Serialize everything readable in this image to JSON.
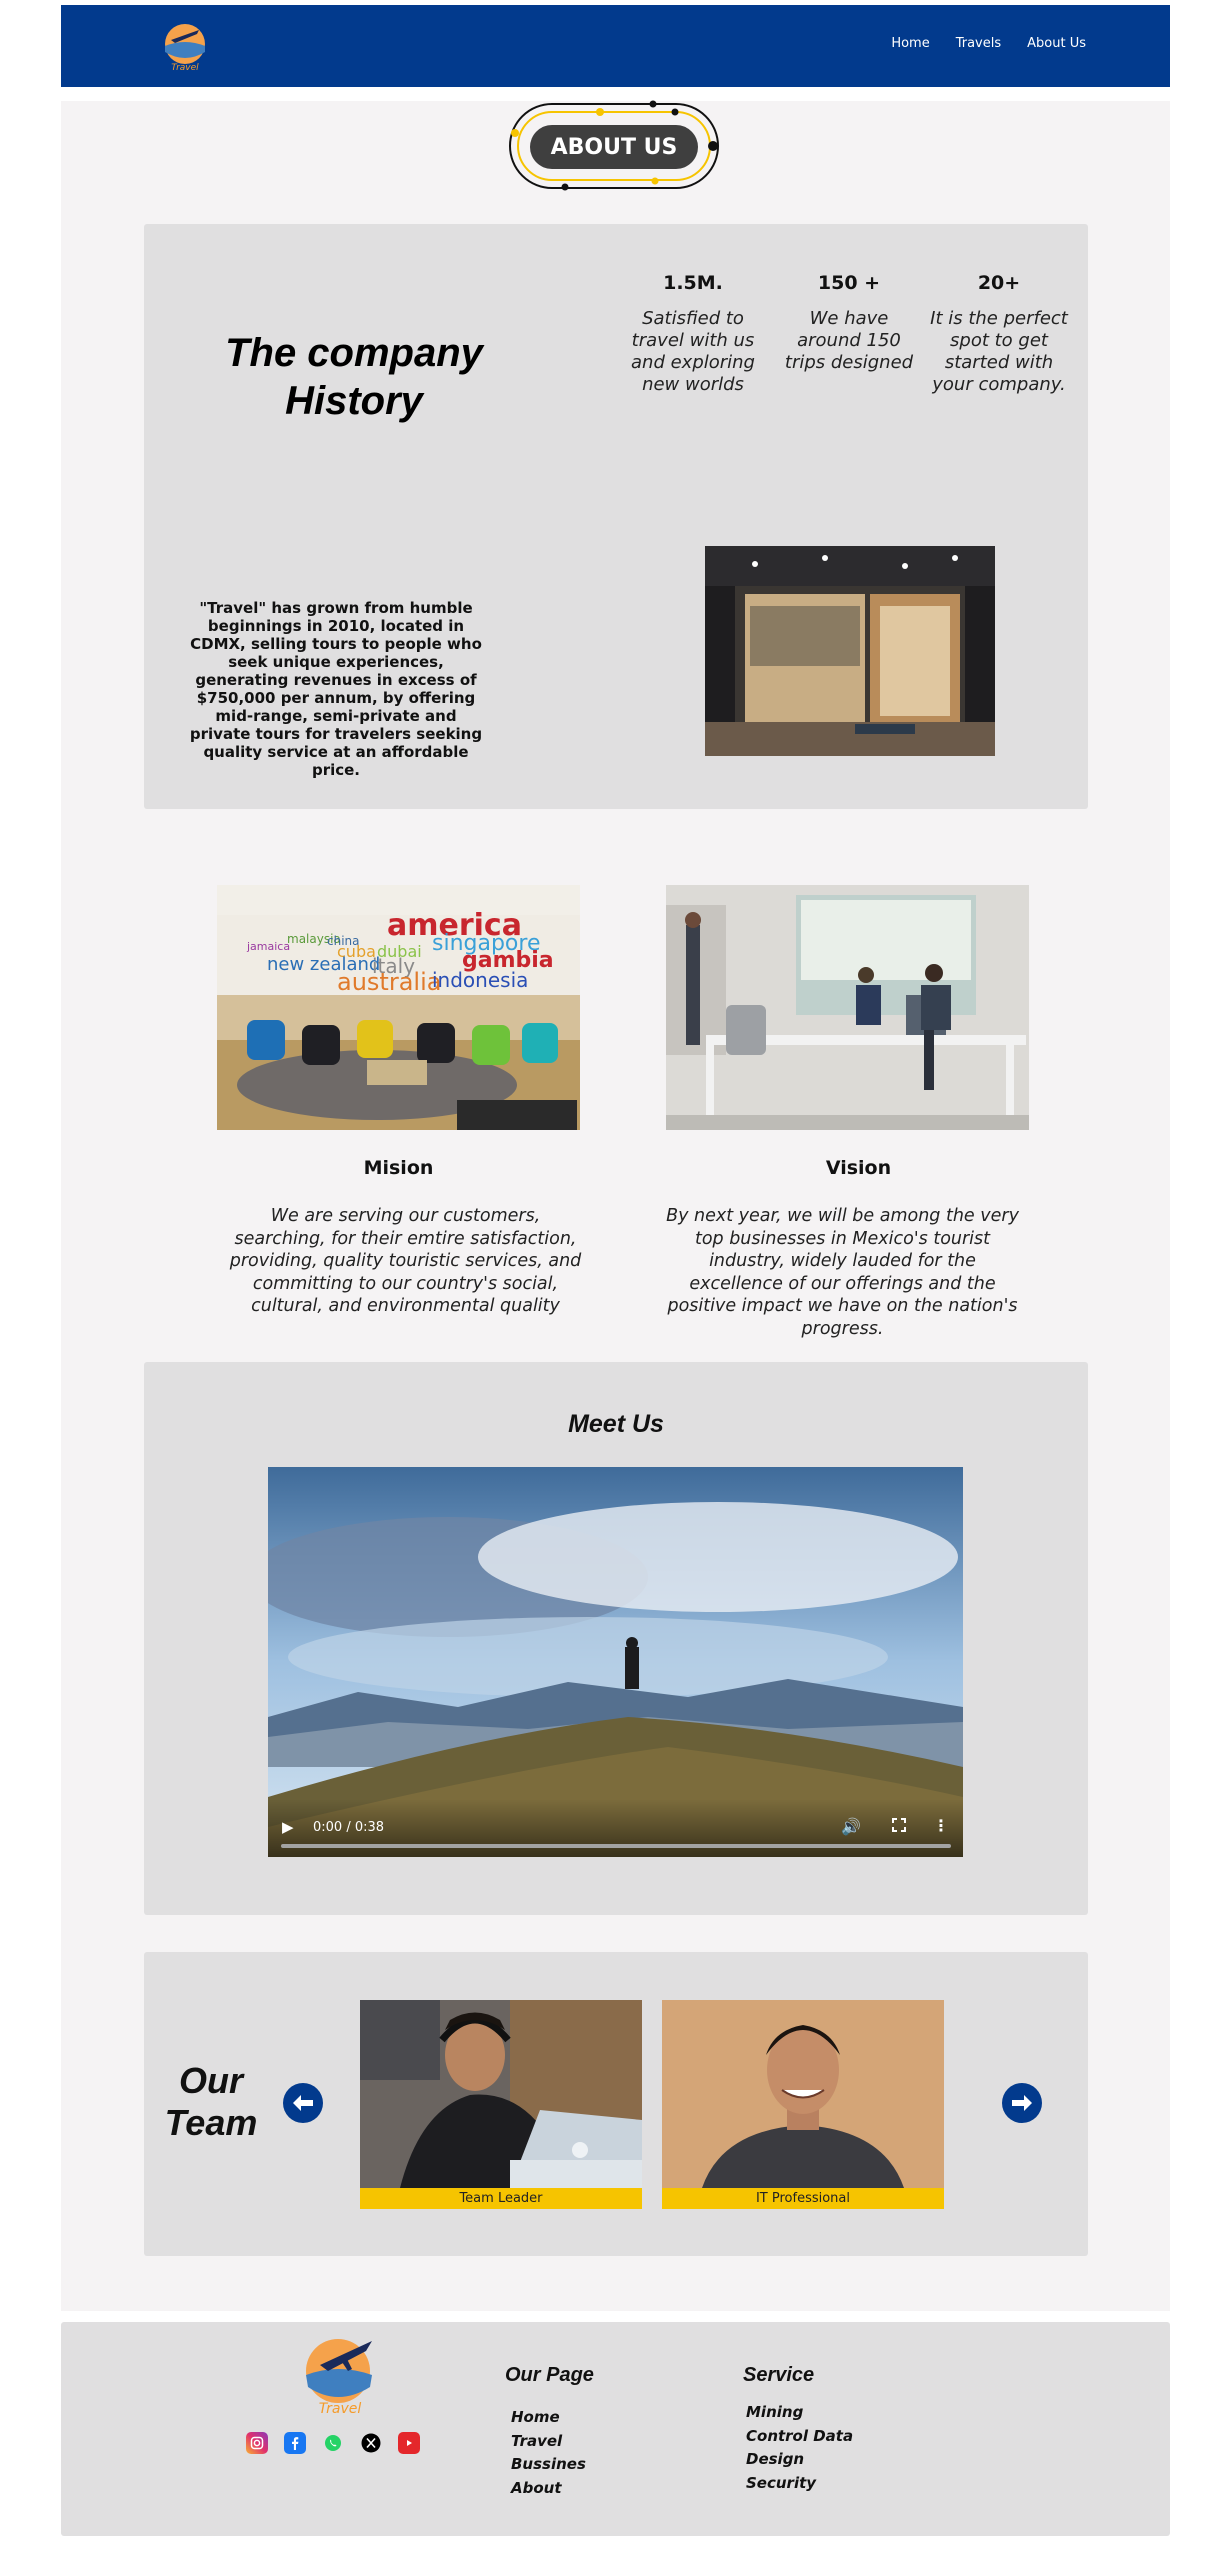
{
  "nav": {
    "items": [
      "Home",
      "Travels",
      "About Us"
    ]
  },
  "badge": {
    "label": "ABOUT US"
  },
  "history": {
    "title": "The company History",
    "stats": [
      {
        "value": "1.5M.",
        "text": "Satisfied to travel with us and exploring new worlds"
      },
      {
        "value": "150 +",
        "text": "We have around 150 trips designed"
      },
      {
        "value": "20+",
        "text": "It is the perfect spot to get started with your company."
      }
    ],
    "paragraph": "\"Travel\" has grown from humble beginnings in 2010, located in CDMX, selling tours to people who seek unique experiences, generating revenues in excess of $750,000 per annum, by offering mid-range, semi-private and private tours for travelers seeking quality service at an affordable price."
  },
  "mission": {
    "title": "Mision",
    "text": "We are serving our customers, searching, for their emtire satisfaction, providing, quality touristic services, and committing to our country's social, cultural, and environmental quality",
    "wall_words": [
      "america",
      "singapore",
      "cuba",
      "dubai",
      "new zealand",
      "italy",
      "gambia",
      "australia",
      "indonesia",
      "malaysia",
      "jamaica",
      "china"
    ]
  },
  "vision": {
    "title": "Vision",
    "text": "By next year, we will be among the very top businesses in Mexico's tourist industry, widely lauded for the excellence of our offerings and the positive impact we have on the nation's progress."
  },
  "meet": {
    "title": "Meet Us",
    "video_time": "0:00 / 0:38"
  },
  "team": {
    "title": "Our Team",
    "members": [
      {
        "role": "Team Leader"
      },
      {
        "role": "IT Professional"
      }
    ]
  },
  "footer": {
    "logo_text": "Travel",
    "socials": [
      "instagram-icon",
      "facebook-icon",
      "whatsapp-icon",
      "x-icon",
      "youtube-icon"
    ],
    "our_page": {
      "title": "Our Page",
      "links": [
        "Home",
        "Travel",
        "Bussines",
        "About"
      ]
    },
    "service": {
      "title": "Service",
      "links": [
        "Mining",
        "Control Data",
        "Design",
        "Security"
      ]
    }
  },
  "colors": {
    "brand_blue": "#023a8d",
    "accent_yellow": "#f6c400",
    "panel_grey": "#e0dfe0"
  }
}
